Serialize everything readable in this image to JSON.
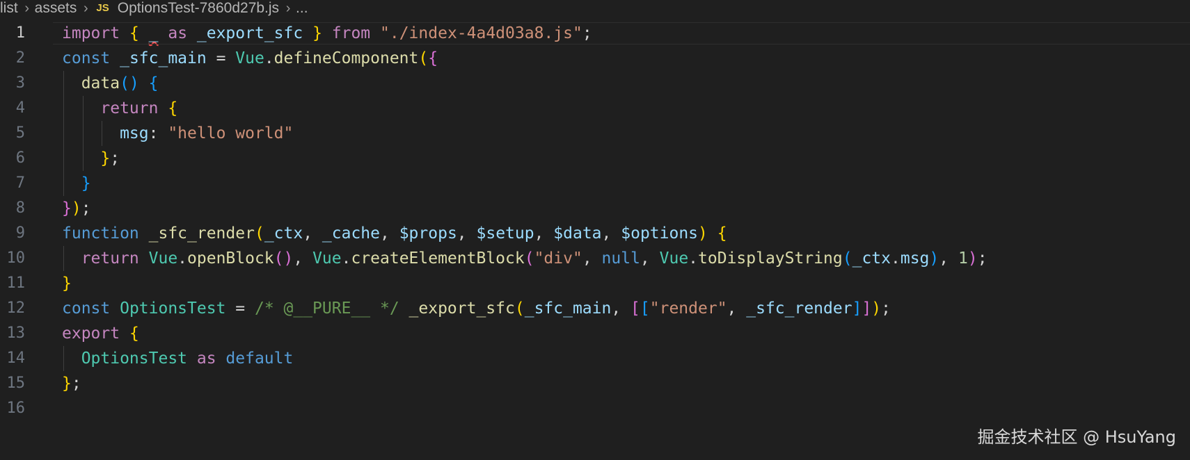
{
  "breadcrumb": {
    "items": [
      "list",
      "assets"
    ],
    "file_badge": "JS",
    "file_name": "OptionsTest-7860d27b.js",
    "more": "..."
  },
  "editor": {
    "current_line": 1,
    "lines": [
      {
        "n": "1",
        "tokens": [
          [
            "import ",
            "kw-purple"
          ],
          [
            "{ ",
            "b1"
          ],
          [
            "_",
            "var squiggle"
          ],
          [
            " as ",
            "kw-purple"
          ],
          [
            "_export_sfc",
            "var"
          ],
          [
            " }",
            "b1"
          ],
          [
            " from ",
            "kw-purple"
          ],
          [
            "\"./index-4a4d03a8.js\"",
            "str"
          ],
          [
            ";",
            "plain"
          ]
        ]
      },
      {
        "n": "2",
        "tokens": [
          [
            "const ",
            "kw-blue"
          ],
          [
            "_sfc_main",
            "var"
          ],
          [
            " = ",
            "plain"
          ],
          [
            "Vue",
            "cls"
          ],
          [
            ".",
            "plain"
          ],
          [
            "defineComponent",
            "fn"
          ],
          [
            "(",
            "b1"
          ],
          [
            "{",
            "b2"
          ]
        ]
      },
      {
        "n": "3",
        "tokens": [
          [
            "  data",
            "fn"
          ],
          [
            "()",
            "b3"
          ],
          [
            " {",
            "b3"
          ]
        ]
      },
      {
        "n": "4",
        "tokens": [
          [
            "    return ",
            "kw-purple"
          ],
          [
            "{",
            "b1"
          ]
        ]
      },
      {
        "n": "5",
        "tokens": [
          [
            "      msg",
            "var"
          ],
          [
            ": ",
            "plain"
          ],
          [
            "\"hello world\"",
            "str"
          ]
        ]
      },
      {
        "n": "6",
        "tokens": [
          [
            "    }",
            "b1"
          ],
          [
            ";",
            "plain"
          ]
        ]
      },
      {
        "n": "7",
        "tokens": [
          [
            "  }",
            "b3"
          ]
        ]
      },
      {
        "n": "8",
        "tokens": [
          [
            "}",
            "b2"
          ],
          [
            ")",
            "b1"
          ],
          [
            ";",
            "plain"
          ]
        ]
      },
      {
        "n": "9",
        "tokens": [
          [
            "function ",
            "kw-blue"
          ],
          [
            "_sfc_render",
            "fn"
          ],
          [
            "(",
            "b1"
          ],
          [
            "_ctx",
            "var"
          ],
          [
            ", ",
            "plain"
          ],
          [
            "_cache",
            "var"
          ],
          [
            ", ",
            "plain"
          ],
          [
            "$props",
            "var"
          ],
          [
            ", ",
            "plain"
          ],
          [
            "$setup",
            "var"
          ],
          [
            ", ",
            "plain"
          ],
          [
            "$data",
            "var"
          ],
          [
            ", ",
            "plain"
          ],
          [
            "$options",
            "var"
          ],
          [
            ")",
            "b1"
          ],
          [
            " {",
            "b1"
          ]
        ]
      },
      {
        "n": "10",
        "tokens": [
          [
            "  return ",
            "kw-purple"
          ],
          [
            "Vue",
            "cls"
          ],
          [
            ".",
            "plain"
          ],
          [
            "openBlock",
            "fn"
          ],
          [
            "()",
            "b2"
          ],
          [
            ", ",
            "plain"
          ],
          [
            "Vue",
            "cls"
          ],
          [
            ".",
            "plain"
          ],
          [
            "createElementBlock",
            "fn"
          ],
          [
            "(",
            "b2"
          ],
          [
            "\"div\"",
            "str"
          ],
          [
            ", ",
            "plain"
          ],
          [
            "null",
            "kw-blue"
          ],
          [
            ", ",
            "plain"
          ],
          [
            "Vue",
            "cls"
          ],
          [
            ".",
            "plain"
          ],
          [
            "toDisplayString",
            "fn"
          ],
          [
            "(",
            "b3"
          ],
          [
            "_ctx",
            "var"
          ],
          [
            ".",
            "plain"
          ],
          [
            "msg",
            "var"
          ],
          [
            ")",
            "b3"
          ],
          [
            ", ",
            "plain"
          ],
          [
            "1",
            "num"
          ],
          [
            ")",
            "b2"
          ],
          [
            ";",
            "plain"
          ]
        ]
      },
      {
        "n": "11",
        "tokens": [
          [
            "}",
            "b1"
          ]
        ]
      },
      {
        "n": "12",
        "tokens": [
          [
            "const ",
            "kw-blue"
          ],
          [
            "OptionsTest",
            "cls"
          ],
          [
            " = ",
            "plain"
          ],
          [
            "/* @__PURE__ */",
            "cmt"
          ],
          [
            " _export_sfc",
            "fn"
          ],
          [
            "(",
            "b1"
          ],
          [
            "_sfc_main",
            "var"
          ],
          [
            ", ",
            "plain"
          ],
          [
            "[",
            "b2"
          ],
          [
            "[",
            "b3"
          ],
          [
            "\"render\"",
            "str"
          ],
          [
            ", ",
            "plain"
          ],
          [
            "_sfc_render",
            "var"
          ],
          [
            "]",
            "b3"
          ],
          [
            "]",
            "b2"
          ],
          [
            ")",
            "b1"
          ],
          [
            ";",
            "plain"
          ]
        ]
      },
      {
        "n": "13",
        "tokens": [
          [
            "export ",
            "kw-purple"
          ],
          [
            "{",
            "b1"
          ]
        ]
      },
      {
        "n": "14",
        "tokens": [
          [
            "  OptionsTest",
            "cls"
          ],
          [
            " as ",
            "kw-purple"
          ],
          [
            "default",
            "kw-blue"
          ]
        ]
      },
      {
        "n": "15",
        "tokens": [
          [
            "}",
            "b1"
          ],
          [
            ";",
            "plain"
          ]
        ]
      },
      {
        "n": "16",
        "tokens": []
      }
    ]
  },
  "watermark": "掘金技术社区 @ HsuYang"
}
